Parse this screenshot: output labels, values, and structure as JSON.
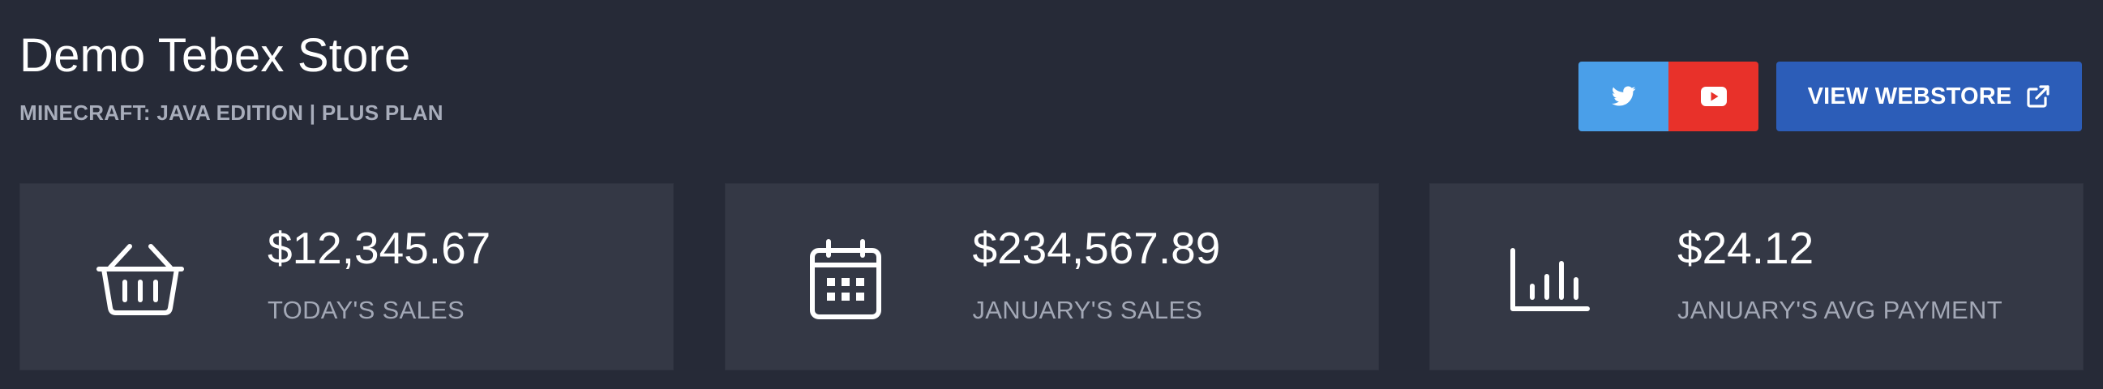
{
  "header": {
    "title": "Demo Tebex Store",
    "subtitle": "MINECRAFT: JAVA EDITION | PLUS PLAN"
  },
  "actions": {
    "twitter_icon": "twitter-icon",
    "youtube_icon": "youtube-icon",
    "webstore_label": "VIEW WEBSTORE",
    "webstore_icon": "external-link-icon",
    "colors": {
      "twitter": "#4a9fe9",
      "youtube": "#e8312a",
      "webstore": "#2c5db8"
    }
  },
  "stats": [
    {
      "icon": "basket-icon",
      "value": "$12,345.67",
      "label": "TODAY'S SALES"
    },
    {
      "icon": "calendar-icon",
      "value": "$234,567.89",
      "label": "JANUARY'S SALES"
    },
    {
      "icon": "bar-chart-icon",
      "value": "$24.12",
      "label": "JANUARY'S AVG PAYMENT"
    }
  ],
  "colors": {
    "background": "#262a37",
    "card": "#343845",
    "muted_text": "#a3a8b6"
  }
}
